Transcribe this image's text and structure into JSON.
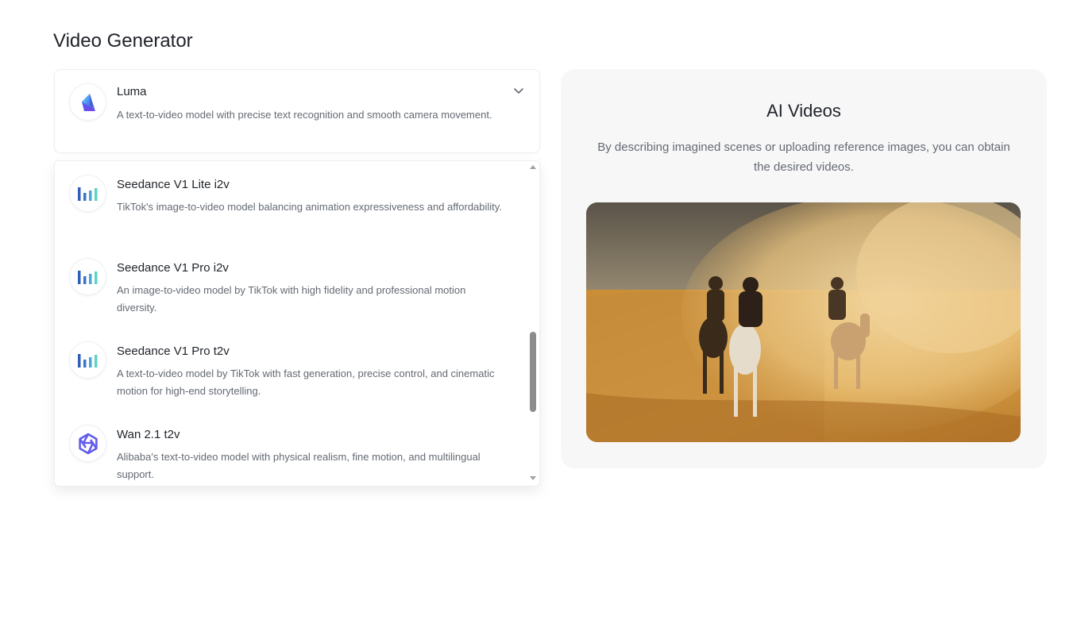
{
  "page": {
    "title": "Video Generator"
  },
  "selected_model": {
    "name": "Luma",
    "description": "A text-to-video model with precise text recognition and smooth camera movement.",
    "icon": "luma-logo-icon"
  },
  "model_list": [
    {
      "name": "Seedance V1 Lite i2v",
      "description": "TikTok's image-to-video model balancing animation expressiveness and affordability.",
      "icon": "seedance-logo-icon"
    },
    {
      "name": "Seedance V1 Pro i2v",
      "description": "An image-to-video model by TikTok with high fidelity and professional motion diversity.",
      "icon": "seedance-logo-icon"
    },
    {
      "name": "Seedance V1 Pro t2v",
      "description": "A text-to-video model by TikTok with fast generation, precise control, and cinematic motion for high-end storytelling.",
      "icon": "seedance-logo-icon"
    },
    {
      "name": "Wan 2.1 t2v",
      "description": "Alibaba's text-to-video model with physical realism, fine motion, and multilingual support.",
      "icon": "wan-logo-icon"
    }
  ],
  "panel": {
    "title": "AI Videos",
    "subtitle": "By describing imagined scenes or uploading reference images, you can obtain the desired videos."
  },
  "colors": {
    "seedance_dark": "#2f5dba",
    "seedance_light": "#5fd1c9",
    "wan_purple": "#615ced",
    "luma_blue": "#3c6ff0",
    "sand": "#d9a24a"
  }
}
